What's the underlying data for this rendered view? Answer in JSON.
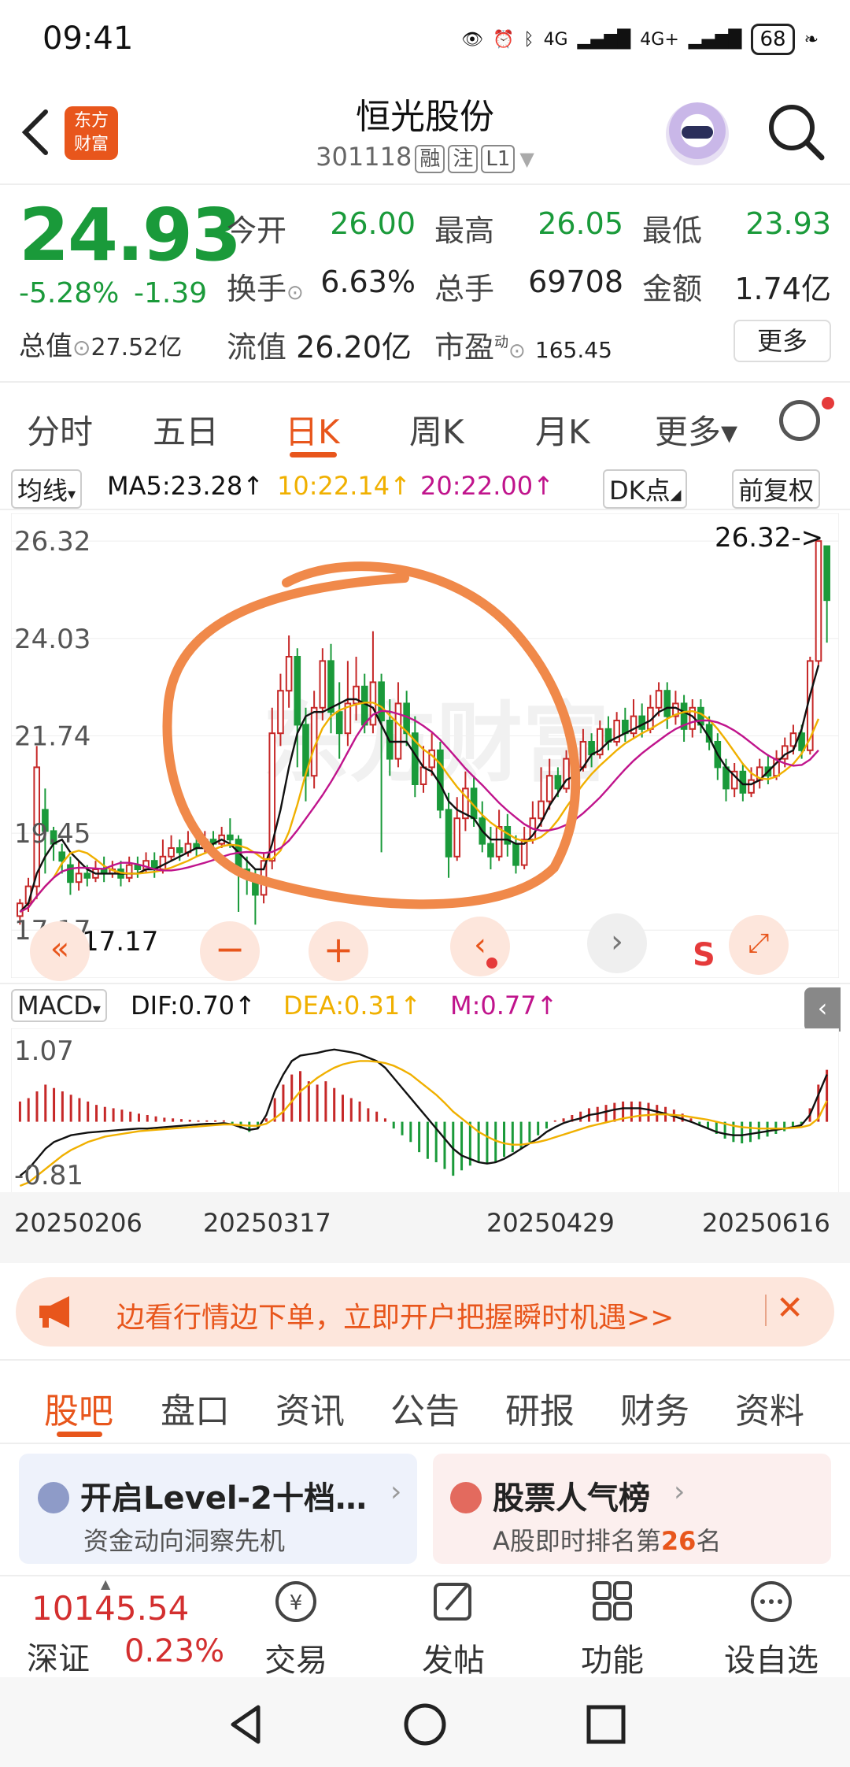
{
  "status_bar": {
    "time": "09:41",
    "signal1": "4G",
    "signal2": "4G+",
    "battery": "68"
  },
  "header": {
    "title": "恒光股份",
    "code": "301118",
    "tags": [
      "融",
      "注",
      "L1"
    ],
    "logo_line1": "东方",
    "logo_line2": "财富"
  },
  "quote": {
    "price": "24.93",
    "change_pct": "-5.28%",
    "change": "-1.39",
    "open_label": "今开",
    "open": "26.00",
    "high_label": "最高",
    "high": "26.05",
    "low_label": "最低",
    "low": "23.93",
    "turnover_label": "换手",
    "turnover": "6.63%",
    "volume_label": "总手",
    "volume": "69708",
    "amount_label": "金额",
    "amount": "1.74亿",
    "mktcap_label": "总值",
    "mktcap": "27.52亿",
    "float_label": "流值",
    "float_cap": "26.20亿",
    "pe_label": "市盈",
    "pe_sup": "动",
    "pe": "165.45",
    "more_label": "更多"
  },
  "period_tabs": [
    "分时",
    "五日",
    "日K",
    "周K",
    "月K",
    "更多▾"
  ],
  "ma_legend": {
    "selector": "均线",
    "ma5": "MA5:23.28↑",
    "ma10": "10:22.14↑",
    "ma20": "20:22.00↑",
    "dk": "DK点",
    "adjust": "前复权"
  },
  "colors": {
    "up": "#c62828",
    "down": "#1a9a3a",
    "ma5": "#111111",
    "ma10": "#f0b000",
    "ma20": "#c0148c",
    "accent": "#e8561c",
    "annotation": "#f0894a"
  },
  "chart_data": {
    "type": "candlestick",
    "y_labels": [
      "26.32",
      "24.03",
      "21.74",
      "19.45",
      "17.17"
    ],
    "ylim": [
      17.17,
      26.32
    ],
    "max_marker": "26.32->",
    "min_marker": "17.17",
    "candles": [
      [
        17.5,
        17.8,
        17.3,
        17.9
      ],
      [
        17.8,
        18.2,
        17.6,
        18.4
      ],
      [
        18.2,
        21.0,
        17.9,
        21.5
      ],
      [
        20.0,
        19.5,
        18.5,
        20.5
      ],
      [
        19.5,
        19.2,
        18.8,
        19.6
      ],
      [
        19.0,
        18.8,
        18.5,
        19.2
      ],
      [
        18.7,
        18.3,
        18.0,
        18.9
      ],
      [
        18.3,
        18.5,
        18.1,
        18.8
      ],
      [
        18.5,
        18.4,
        18.2,
        18.7
      ],
      [
        18.4,
        18.6,
        18.3,
        18.8
      ],
      [
        18.6,
        18.5,
        18.3,
        18.9
      ],
      [
        18.5,
        18.6,
        18.4,
        18.8
      ],
      [
        18.6,
        18.4,
        18.2,
        18.8
      ],
      [
        18.4,
        18.7,
        18.3,
        18.9
      ],
      [
        18.7,
        18.6,
        18.4,
        18.9
      ],
      [
        18.6,
        18.8,
        18.5,
        19.0
      ],
      [
        18.8,
        18.6,
        18.4,
        19.0
      ],
      [
        18.6,
        18.9,
        18.5,
        19.3
      ],
      [
        18.9,
        19.1,
        18.8,
        19.4
      ],
      [
        19.1,
        19.0,
        18.8,
        19.3
      ],
      [
        19.0,
        19.2,
        18.9,
        19.5
      ],
      [
        19.2,
        19.1,
        18.9,
        19.4
      ],
      [
        19.1,
        19.3,
        19.0,
        19.5
      ],
      [
        19.3,
        19.2,
        19.0,
        19.5
      ],
      [
        19.2,
        19.4,
        19.1,
        19.6
      ],
      [
        19.4,
        19.3,
        19.1,
        19.8
      ],
      [
        19.3,
        18.6,
        17.6,
        19.4
      ],
      [
        18.6,
        18.4,
        18.0,
        18.9
      ],
      [
        18.4,
        18.0,
        17.3,
        18.6
      ],
      [
        18.0,
        18.8,
        17.8,
        19.0
      ],
      [
        18.8,
        21.8,
        18.6,
        22.4
      ],
      [
        21.8,
        22.8,
        21.5,
        23.2
      ],
      [
        22.8,
        23.6,
        22.4,
        24.1
      ],
      [
        23.6,
        22.0,
        21.0,
        23.8
      ],
      [
        22.0,
        20.8,
        20.2,
        22.4
      ],
      [
        20.8,
        22.4,
        20.5,
        22.8
      ],
      [
        22.4,
        23.5,
        22.1,
        23.8
      ],
      [
        23.5,
        22.3,
        21.8,
        23.9
      ],
      [
        22.3,
        21.8,
        21.2,
        23.0
      ],
      [
        21.8,
        22.5,
        21.5,
        23.5
      ],
      [
        22.5,
        22.9,
        22.1,
        23.6
      ],
      [
        22.9,
        22.0,
        21.8,
        23.2
      ],
      [
        22.0,
        23.0,
        21.8,
        24.2
      ],
      [
        23.0,
        22.1,
        19.0,
        23.2
      ],
      [
        22.1,
        21.2,
        20.8,
        22.6
      ],
      [
        21.2,
        22.5,
        21.0,
        23.0
      ],
      [
        22.5,
        21.8,
        21.5,
        22.8
      ],
      [
        21.8,
        20.6,
        20.3,
        22.2
      ],
      [
        20.6,
        21.0,
        20.4,
        21.5
      ],
      [
        21.0,
        21.4,
        20.8,
        21.8
      ],
      [
        21.4,
        20.0,
        19.8,
        21.6
      ],
      [
        20.0,
        18.9,
        18.4,
        20.4
      ],
      [
        18.9,
        19.8,
        18.8,
        20.3
      ],
      [
        19.8,
        20.5,
        19.5,
        20.9
      ],
      [
        20.5,
        19.8,
        19.6,
        20.8
      ],
      [
        19.8,
        19.2,
        19.0,
        20.2
      ],
      [
        19.2,
        18.9,
        18.6,
        19.6
      ],
      [
        18.9,
        19.6,
        18.8,
        20.0
      ],
      [
        19.6,
        19.2,
        18.9,
        19.9
      ],
      [
        19.2,
        18.7,
        18.5,
        19.4
      ],
      [
        18.7,
        19.3,
        18.6,
        19.6
      ],
      [
        19.3,
        19.8,
        19.2,
        20.2
      ],
      [
        19.8,
        20.2,
        19.6,
        21.0
      ],
      [
        20.2,
        20.8,
        20.0,
        21.2
      ],
      [
        20.8,
        20.5,
        20.3,
        21.0
      ],
      [
        20.5,
        21.2,
        20.4,
        21.4
      ],
      [
        21.2,
        21.0,
        20.7,
        21.5
      ],
      [
        21.0,
        21.6,
        20.9,
        21.9
      ],
      [
        21.6,
        21.3,
        21.0,
        21.8
      ],
      [
        21.3,
        21.9,
        21.2,
        22.1
      ],
      [
        21.9,
        21.6,
        21.4,
        22.2
      ],
      [
        21.6,
        22.1,
        21.5,
        22.3
      ],
      [
        22.1,
        21.8,
        21.6,
        22.4
      ],
      [
        21.8,
        22.2,
        21.7,
        22.6
      ],
      [
        22.2,
        21.9,
        21.7,
        22.5
      ],
      [
        21.9,
        22.4,
        21.8,
        22.7
      ],
      [
        22.4,
        22.8,
        22.2,
        23.0
      ],
      [
        22.8,
        22.2,
        21.9,
        23.0
      ],
      [
        22.2,
        22.5,
        22.0,
        22.8
      ],
      [
        22.5,
        21.9,
        21.6,
        22.7
      ],
      [
        21.9,
        22.4,
        21.7,
        22.6
      ],
      [
        22.4,
        22.0,
        21.8,
        22.6
      ],
      [
        22.0,
        21.6,
        21.4,
        22.2
      ],
      [
        21.6,
        21.0,
        20.7,
        21.8
      ],
      [
        21.0,
        20.5,
        20.2,
        21.2
      ],
      [
        20.5,
        20.9,
        20.3,
        21.1
      ],
      [
        20.9,
        20.4,
        20.2,
        21.1
      ],
      [
        20.4,
        20.7,
        20.3,
        21.0
      ],
      [
        20.7,
        21.0,
        20.5,
        21.2
      ],
      [
        21.0,
        20.8,
        20.6,
        21.3
      ],
      [
        20.8,
        21.2,
        20.7,
        21.4
      ],
      [
        21.2,
        21.5,
        21.0,
        21.7
      ],
      [
        21.5,
        21.8,
        21.3,
        22.0
      ],
      [
        21.8,
        21.4,
        21.2,
        22.0
      ],
      [
        21.4,
        23.5,
        21.3,
        23.6
      ],
      [
        23.5,
        26.32,
        23.4,
        26.32
      ],
      [
        26.2,
        24.93,
        23.93,
        26.05
      ]
    ],
    "ma5": [
      17.6,
      17.8,
      18.5,
      18.9,
      19.2,
      19.3,
      19.0,
      18.8,
      18.6,
      18.5,
      18.5,
      18.5,
      18.5,
      18.5,
      18.5,
      18.6,
      18.6,
      18.7,
      18.8,
      18.9,
      19.0,
      19.1,
      19.1,
      19.2,
      19.3,
      19.2,
      19.0,
      18.8,
      18.6,
      18.6,
      19.2,
      20.0,
      21.0,
      21.8,
      22.2,
      22.3,
      22.3,
      22.4,
      22.5,
      22.6,
      22.6,
      22.5,
      22.4,
      22.0,
      21.6,
      21.6,
      21.6,
      21.3,
      21.0,
      20.9,
      20.6,
      20.2,
      20.0,
      19.9,
      19.8,
      19.5,
      19.3,
      19.3,
      19.3,
      19.2,
      19.2,
      19.4,
      19.7,
      20.1,
      20.4,
      20.7,
      20.8,
      21.0,
      21.3,
      21.4,
      21.6,
      21.7,
      21.8,
      21.9,
      22.0,
      22.1,
      22.3,
      22.4,
      22.4,
      22.3,
      22.2,
      22.0,
      21.7,
      21.3,
      21.0,
      20.8,
      20.6,
      20.6,
      20.7,
      20.9,
      21.1,
      21.3,
      21.4,
      21.9,
      22.7,
      23.4
    ]
  },
  "macd_legend": {
    "selector": "MACD",
    "dif": "DIF:0.70↑",
    "dea": "DEA:0.31↑",
    "m": "M:0.77↑"
  },
  "macd_data": {
    "y_labels": [
      "1.07",
      "-0.81"
    ],
    "histogram": [
      0.3,
      0.35,
      0.45,
      0.55,
      0.5,
      0.45,
      0.4,
      0.35,
      0.3,
      0.25,
      0.22,
      0.2,
      0.18,
      0.15,
      0.12,
      0.1,
      0.08,
      0.06,
      0.05,
      0.04,
      0.03,
      0.02,
      0.02,
      0.02,
      0.02,
      -0.05,
      -0.1,
      -0.15,
      -0.1,
      0.05,
      0.35,
      0.55,
      0.7,
      0.75,
      0.6,
      0.55,
      0.6,
      0.5,
      0.4,
      0.35,
      0.3,
      0.2,
      0.15,
      0.05,
      -0.1,
      -0.2,
      -0.3,
      -0.45,
      -0.55,
      -0.6,
      -0.7,
      -0.8,
      -0.72,
      -0.65,
      -0.6,
      -0.62,
      -0.6,
      -0.52,
      -0.45,
      -0.4,
      -0.3,
      -0.2,
      -0.1,
      0.02,
      0.05,
      0.1,
      0.15,
      0.2,
      0.22,
      0.25,
      0.28,
      0.3,
      0.3,
      0.3,
      0.28,
      0.25,
      0.22,
      0.18,
      0.12,
      0.05,
      -0.05,
      -0.1,
      -0.18,
      -0.25,
      -0.3,
      -0.32,
      -0.3,
      -0.26,
      -0.22,
      -0.18,
      -0.14,
      -0.1,
      -0.05,
      0.2,
      0.55,
      0.77
    ],
    "dif": [
      -0.8,
      -0.7,
      -0.55,
      -0.4,
      -0.3,
      -0.25,
      -0.2,
      -0.18,
      -0.16,
      -0.15,
      -0.14,
      -0.13,
      -0.12,
      -0.11,
      -0.1,
      -0.1,
      -0.09,
      -0.08,
      -0.07,
      -0.06,
      -0.05,
      -0.04,
      -0.03,
      -0.03,
      -0.02,
      -0.04,
      -0.08,
      -0.12,
      -0.1,
      0.1,
      0.45,
      0.7,
      0.9,
      0.98,
      1.0,
      1.02,
      1.05,
      1.07,
      1.05,
      1.03,
      1.0,
      0.95,
      0.9,
      0.8,
      0.65,
      0.5,
      0.35,
      0.2,
      0.05,
      -0.1,
      -0.25,
      -0.4,
      -0.5,
      -0.55,
      -0.6,
      -0.62,
      -0.6,
      -0.55,
      -0.48,
      -0.4,
      -0.32,
      -0.25,
      -0.15,
      -0.08,
      -0.02,
      0.02,
      0.05,
      0.1,
      0.12,
      0.15,
      0.18,
      0.2,
      0.2,
      0.2,
      0.18,
      0.15,
      0.12,
      0.08,
      0.04,
      0.0,
      -0.05,
      -0.1,
      -0.15,
      -0.18,
      -0.2,
      -0.2,
      -0.18,
      -0.16,
      -0.14,
      -0.12,
      -0.1,
      -0.08,
      -0.05,
      0.1,
      0.4,
      0.7
    ],
    "dea": [
      -0.95,
      -0.9,
      -0.8,
      -0.7,
      -0.6,
      -0.5,
      -0.42,
      -0.36,
      -0.3,
      -0.26,
      -0.22,
      -0.2,
      -0.18,
      -0.16,
      -0.14,
      -0.13,
      -0.12,
      -0.11,
      -0.1,
      -0.09,
      -0.08,
      -0.07,
      -0.06,
      -0.05,
      -0.04,
      -0.04,
      -0.05,
      -0.06,
      -0.06,
      -0.03,
      0.05,
      0.15,
      0.3,
      0.45,
      0.55,
      0.65,
      0.73,
      0.8,
      0.85,
      0.88,
      0.9,
      0.9,
      0.89,
      0.87,
      0.83,
      0.77,
      0.7,
      0.6,
      0.5,
      0.4,
      0.28,
      0.15,
      0.05,
      -0.05,
      -0.15,
      -0.22,
      -0.28,
      -0.32,
      -0.34,
      -0.34,
      -0.32,
      -0.3,
      -0.27,
      -0.23,
      -0.19,
      -0.15,
      -0.11,
      -0.07,
      -0.04,
      -0.01,
      0.02,
      0.05,
      0.07,
      0.09,
      0.1,
      0.11,
      0.11,
      0.1,
      0.09,
      0.07,
      0.05,
      0.03,
      0.0,
      -0.03,
      -0.06,
      -0.08,
      -0.09,
      -0.1,
      -0.1,
      -0.1,
      -0.1,
      -0.09,
      -0.08,
      -0.05,
      0.05,
      0.31
    ]
  },
  "x_dates": [
    "20250206",
    "20250317",
    "20250429",
    "20250616"
  ],
  "banner": {
    "text": "边看行情边下单，立即开户把握瞬时机遇>>"
  },
  "info_tabs": [
    "股吧",
    "盘口",
    "资讯",
    "公告",
    "研报",
    "财务",
    "资料"
  ],
  "cards": [
    {
      "title": "开启Level-2十档…",
      "subtitle": "资金动向洞察先机"
    },
    {
      "title": "股票人气榜",
      "subtitle_pre": "A股即时排名第",
      "rank": "26",
      "subtitle_post": "名"
    }
  ],
  "bottom": {
    "index_value": "10145.54",
    "index_name": "深证",
    "index_pct": "0.23%",
    "items": [
      "交易",
      "发帖",
      "功能",
      "设自选"
    ]
  }
}
